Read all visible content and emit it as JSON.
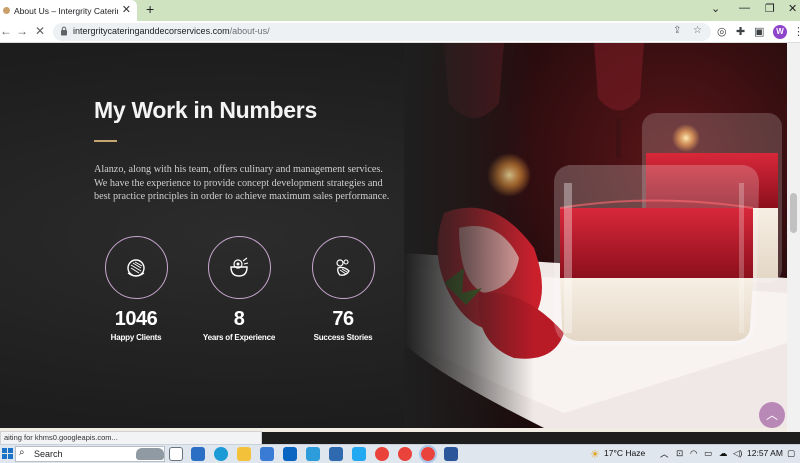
{
  "browser": {
    "tab_title": "About Us – Intergrity Catering an",
    "new_tab_label": "+",
    "url_host": "intergritycateringanddecorservices.com",
    "url_path": "/about-us/",
    "profile_initial": "W",
    "status_text": "aiting for khms0.googleapis.com..."
  },
  "section": {
    "title": "My Work in Numbers",
    "intro_lines": [
      "Alanzo, along with his team, offers culinary and management services.",
      "We have the experience to provide concept development strategies and",
      "best practice principles in order to achieve maximum sales performance."
    ],
    "stats": [
      {
        "value": "1046",
        "label": "Happy Clients",
        "icon": "dish-icon"
      },
      {
        "value": "8",
        "label": "Years of Experience",
        "icon": "cooking-pot-icon"
      },
      {
        "value": "76",
        "label": "Success Stories",
        "icon": "herb-icon"
      }
    ],
    "scroll_top_icon": "chevron-up-icon"
  },
  "taskbar": {
    "search_label": "Search",
    "weather": "17°C  Haze",
    "time": "12:57 AM"
  },
  "colors": {
    "accent_gold": "#c5a572",
    "ring_lilac": "#c8a6cf",
    "button_mauve": "#b889b7",
    "dark_bg": "#1e1e1e"
  }
}
